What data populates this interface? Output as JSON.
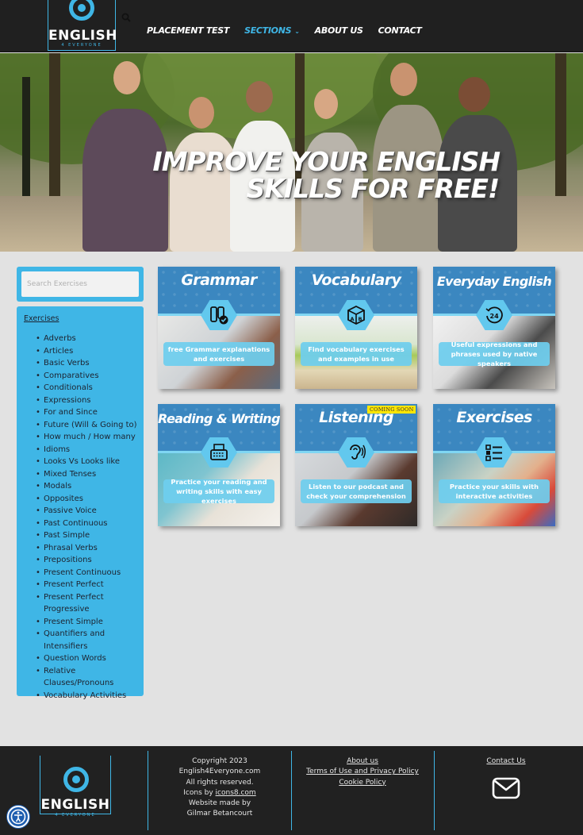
{
  "brand": {
    "logo_word": "ENGLISH",
    "logo_sub": "4 EVERYONE"
  },
  "nav": {
    "items": [
      {
        "label": "PLACEMENT TEST",
        "active": false
      },
      {
        "label": "SECTIONS",
        "active": true
      },
      {
        "label": "ABOUT US",
        "active": false
      },
      {
        "label": "CONTACT",
        "active": false
      }
    ]
  },
  "hero": {
    "line1": "IMPROVE YOUR ENGLISH",
    "line2": "SKILLS FOR FREE!"
  },
  "search": {
    "placeholder": "Search Exercises",
    "value": ""
  },
  "sidebar": {
    "title": "Exercises",
    "items": [
      "Adverbs",
      "Articles",
      "Basic Verbs",
      "Comparatives",
      "Conditionals",
      "Expressions",
      "For and Since",
      "Future (Will & Going to)",
      "How much / How many",
      "Idioms",
      "Looks Vs Looks like",
      "Mixed Tenses",
      "Modals",
      "Opposites",
      "Passive Voice",
      "Past Continuous",
      "Past Simple",
      "Phrasal Verbs",
      "Prepositions",
      "Present Continuous",
      "Present Perfect",
      "Present Perfect Progressive",
      "Present Simple",
      "Quantifiers and Intensifiers",
      "Question Words",
      "Relative Clauses/Pronouns",
      "Vocabulary Activities"
    ]
  },
  "cards": [
    {
      "title": "Grammar",
      "caption": "free Grammar explanations and exercises",
      "icon": "traffic-light-check-icon"
    },
    {
      "title": "Vocabulary",
      "caption": "Find vocabulary exercises and examples in use",
      "icon": "abc-cube-icon"
    },
    {
      "title": "Everyday English",
      "caption": "Useful expressions and phrases used by native speakers",
      "icon": "24-hours-icon"
    },
    {
      "title": "Reading & Writing",
      "caption": "Practice your reading and writing skills with easy exercises",
      "icon": "typewriter-icon"
    },
    {
      "title": "Listening",
      "caption": "Listen to our podcast and check your comprehension",
      "icon": "listening-ear-icon",
      "badge": "COMING SOON"
    },
    {
      "title": "Exercises",
      "caption": "Practice your skills with interactive activities",
      "icon": "checklist-icon"
    }
  ],
  "footer": {
    "copyright": "Copyright 2023",
    "site": "English4Everyone.com",
    "rights": "All rights reserved.",
    "icons_prefix": "Icons by ",
    "icons_link": "icons8.com",
    "made_by": "Website made by",
    "author": "Gilmar Betancourt",
    "links": [
      "About us",
      "Terms of Use and Privacy Policy",
      "Cookie Policy"
    ],
    "contact": "Contact Us"
  },
  "colors": {
    "accent": "#3fb6e6",
    "dark": "#212121",
    "card_blue": "#3b87c0",
    "background": "#e2e2e2"
  }
}
